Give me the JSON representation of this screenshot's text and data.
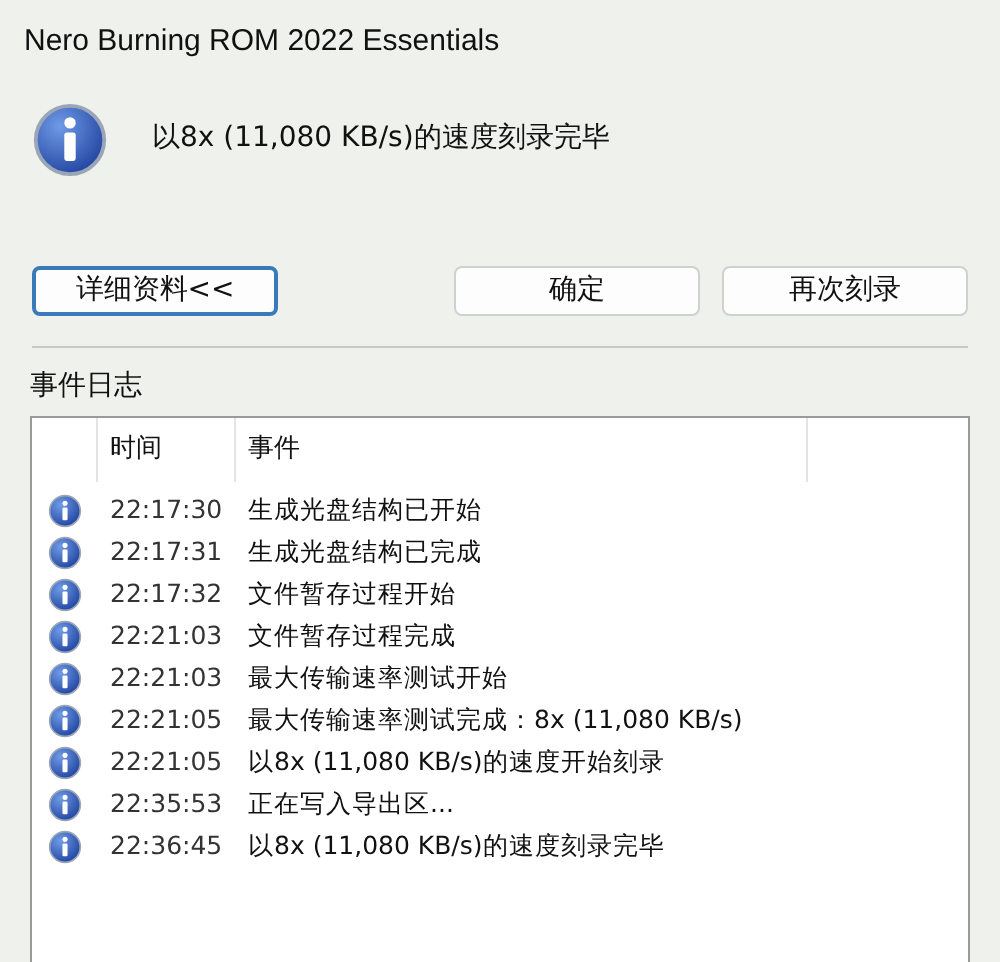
{
  "window": {
    "title": "Nero Burning ROM 2022 Essentials"
  },
  "message": "以8x (11,080 KB/s)的速度刻录完毕",
  "buttons": [
    {
      "label": "详细资料<<",
      "focused": true
    },
    {
      "label": "确定",
      "focused": false
    },
    {
      "label": "再次刻录",
      "focused": false
    }
  ],
  "event_log": {
    "label": "事件日志",
    "columns": [
      "时间",
      "事件"
    ],
    "rows": [
      {
        "time": "22:17:30",
        "event": "生成光盘结构已开始"
      },
      {
        "time": "22:17:31",
        "event": "生成光盘结构已完成"
      },
      {
        "time": "22:17:32",
        "event": "文件暂存过程开始"
      },
      {
        "time": "22:21:03",
        "event": "文件暂存过程完成"
      },
      {
        "time": "22:21:03",
        "event": "最大传输速率测试开始"
      },
      {
        "time": "22:21:05",
        "event": "最大传输速率测试完成：8x (11,080 KB/s)"
      },
      {
        "time": "22:21:05",
        "event": "以8x (11,080 KB/s)的速度开始刻录"
      },
      {
        "time": "22:35:53",
        "event": "正在写入导出区..."
      },
      {
        "time": "22:36:45",
        "event": "以8x (11,080 KB/s)的速度刻录完毕"
      }
    ]
  }
}
